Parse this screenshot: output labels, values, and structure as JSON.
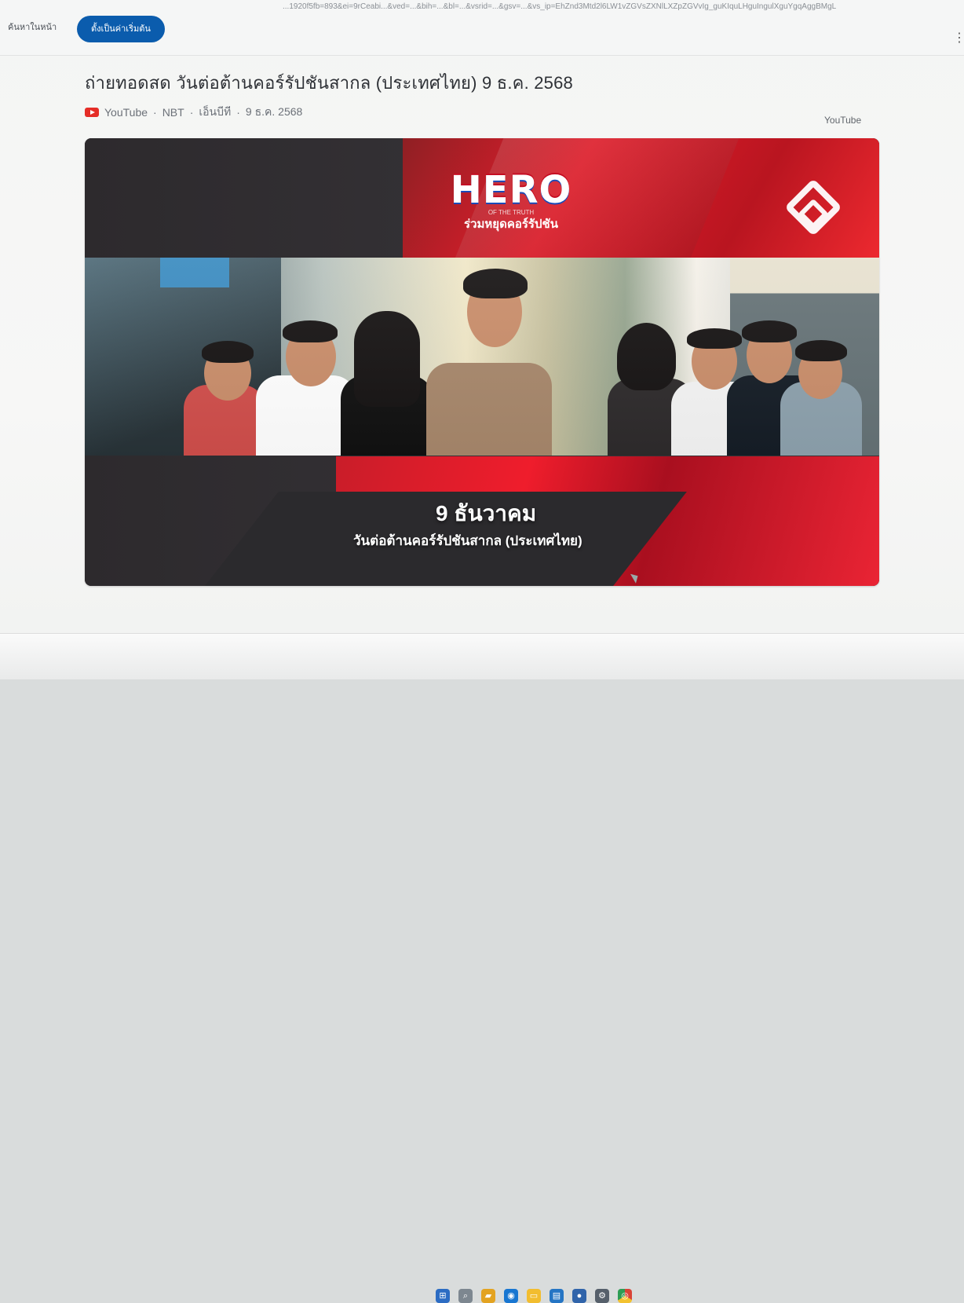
{
  "browser": {
    "url_fragment": "...1920f5fb=893&ei=9rCeabi...&ved=...&bih=...&bl=...&vsrid=...&gsv=...&vs_ip=EhZnd3Mtd2l6LW1vZGVsZXNlLXZpZGVvIg_guKIquLHguIngulXguYgqAggBMgL",
    "search_in_page": "ค้นหาในหน้า",
    "set_default_button": "ตั้งเป็นค่าเริ่มต้น",
    "more_icon": "more-icon"
  },
  "result": {
    "title": "ถ่ายทอดสด วันต่อต้านคอร์รัปชันสากล (ประเทศไทย) 9 ธ.ค. 2568",
    "platform": "YouTube",
    "channel": "NBT",
    "location": "เอ็นบีที",
    "date": "9 ธ.ค. 2568",
    "source_label": "YouTube"
  },
  "thumbnail": {
    "hero_word": "HERO",
    "hero_subtitle": "OF THE TRUTH",
    "hero_thai": "ร่วมหยุดคอร์รัปชัน",
    "date_text": "9 ธันวาคม",
    "event_text": "วันต่อต้านคอร์รัปชันสากล (ประเทศไทย)",
    "logo_icon": "nbt-logo-icon"
  },
  "taskbar": {
    "icons": [
      "windows-start-icon",
      "search-icon",
      "file-explorer-icon",
      "browser-icon",
      "folder-icon",
      "store-icon",
      "app-icon",
      "settings-icon",
      "chrome-icon"
    ]
  },
  "colors": {
    "primary_button": "#0b5cad",
    "youtube_red": "#e52d27",
    "banner_red": "#e21e2b"
  }
}
